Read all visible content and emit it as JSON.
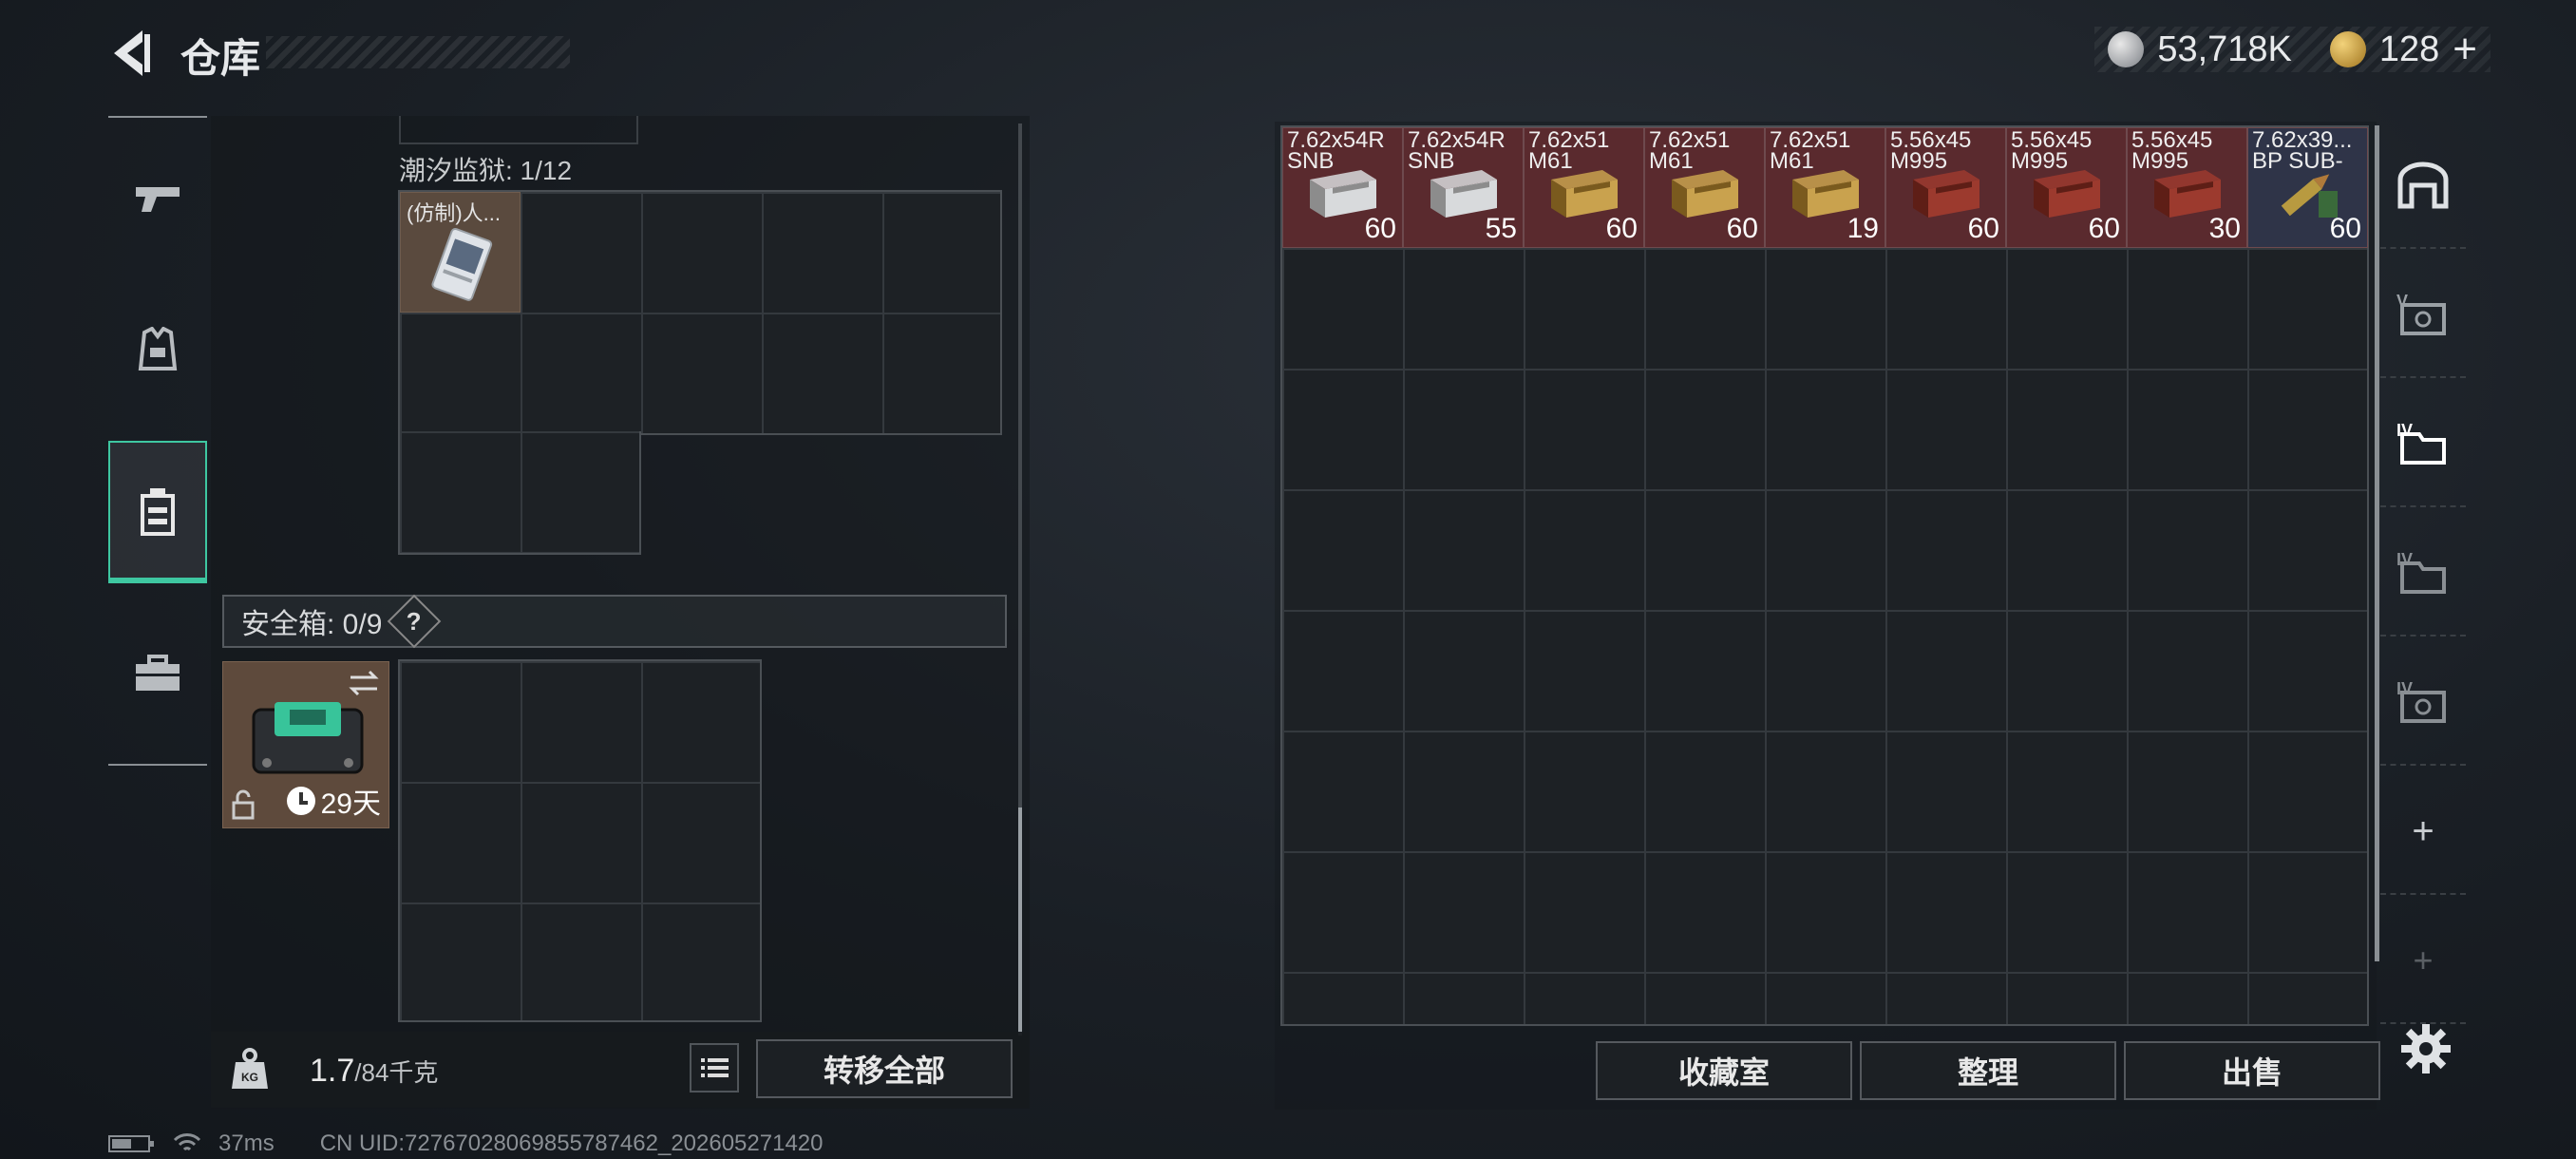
{
  "header": {
    "title": "仓库",
    "currency_silver": "53,718K",
    "currency_gold": "128",
    "plus_label": "+"
  },
  "left": {
    "container_label": "潮汐监狱: 1/12",
    "container_item": "(仿制)人...",
    "safe_label": "安全箱: 0/9",
    "safe_help": "?",
    "safe_days": "29天",
    "weight_current": "1.7",
    "weight_max": "/84千克",
    "transfer_all": "转移全部"
  },
  "right": {
    "ammo": [
      {
        "name": "7.62x54R\nSNB",
        "count": "60",
        "style": "silver"
      },
      {
        "name": "7.62x54R\nSNB",
        "count": "55",
        "style": "silver"
      },
      {
        "name": "7.62x51\nM61",
        "count": "60",
        "style": "gold"
      },
      {
        "name": "7.62x51\nM61",
        "count": "60",
        "style": "gold"
      },
      {
        "name": "7.62x51\nM61",
        "count": "19",
        "style": "gold"
      },
      {
        "name": "5.56x45\nM995",
        "count": "60",
        "style": "red"
      },
      {
        "name": "5.56x45\nM995",
        "count": "60",
        "style": "red"
      },
      {
        "name": "5.56x45\nM995",
        "count": "30",
        "style": "red"
      },
      {
        "name": "7.62x39...\nBP SUB-",
        "count": "60",
        "style": "bullet"
      }
    ],
    "buttons": {
      "collection": "收藏室",
      "sort": "整理",
      "sell": "出售"
    },
    "side_tabs": [
      "IV",
      "V",
      "IV",
      "IV",
      "IV"
    ]
  },
  "status": {
    "ping": "37ms",
    "uid": "CN UID:727670280698557874​62_202605271420"
  },
  "colors": {
    "accent": "#3ec7a1",
    "ammo_red_bg": "#5a2a2e",
    "ammo_blue_bg": "#2f3448"
  }
}
